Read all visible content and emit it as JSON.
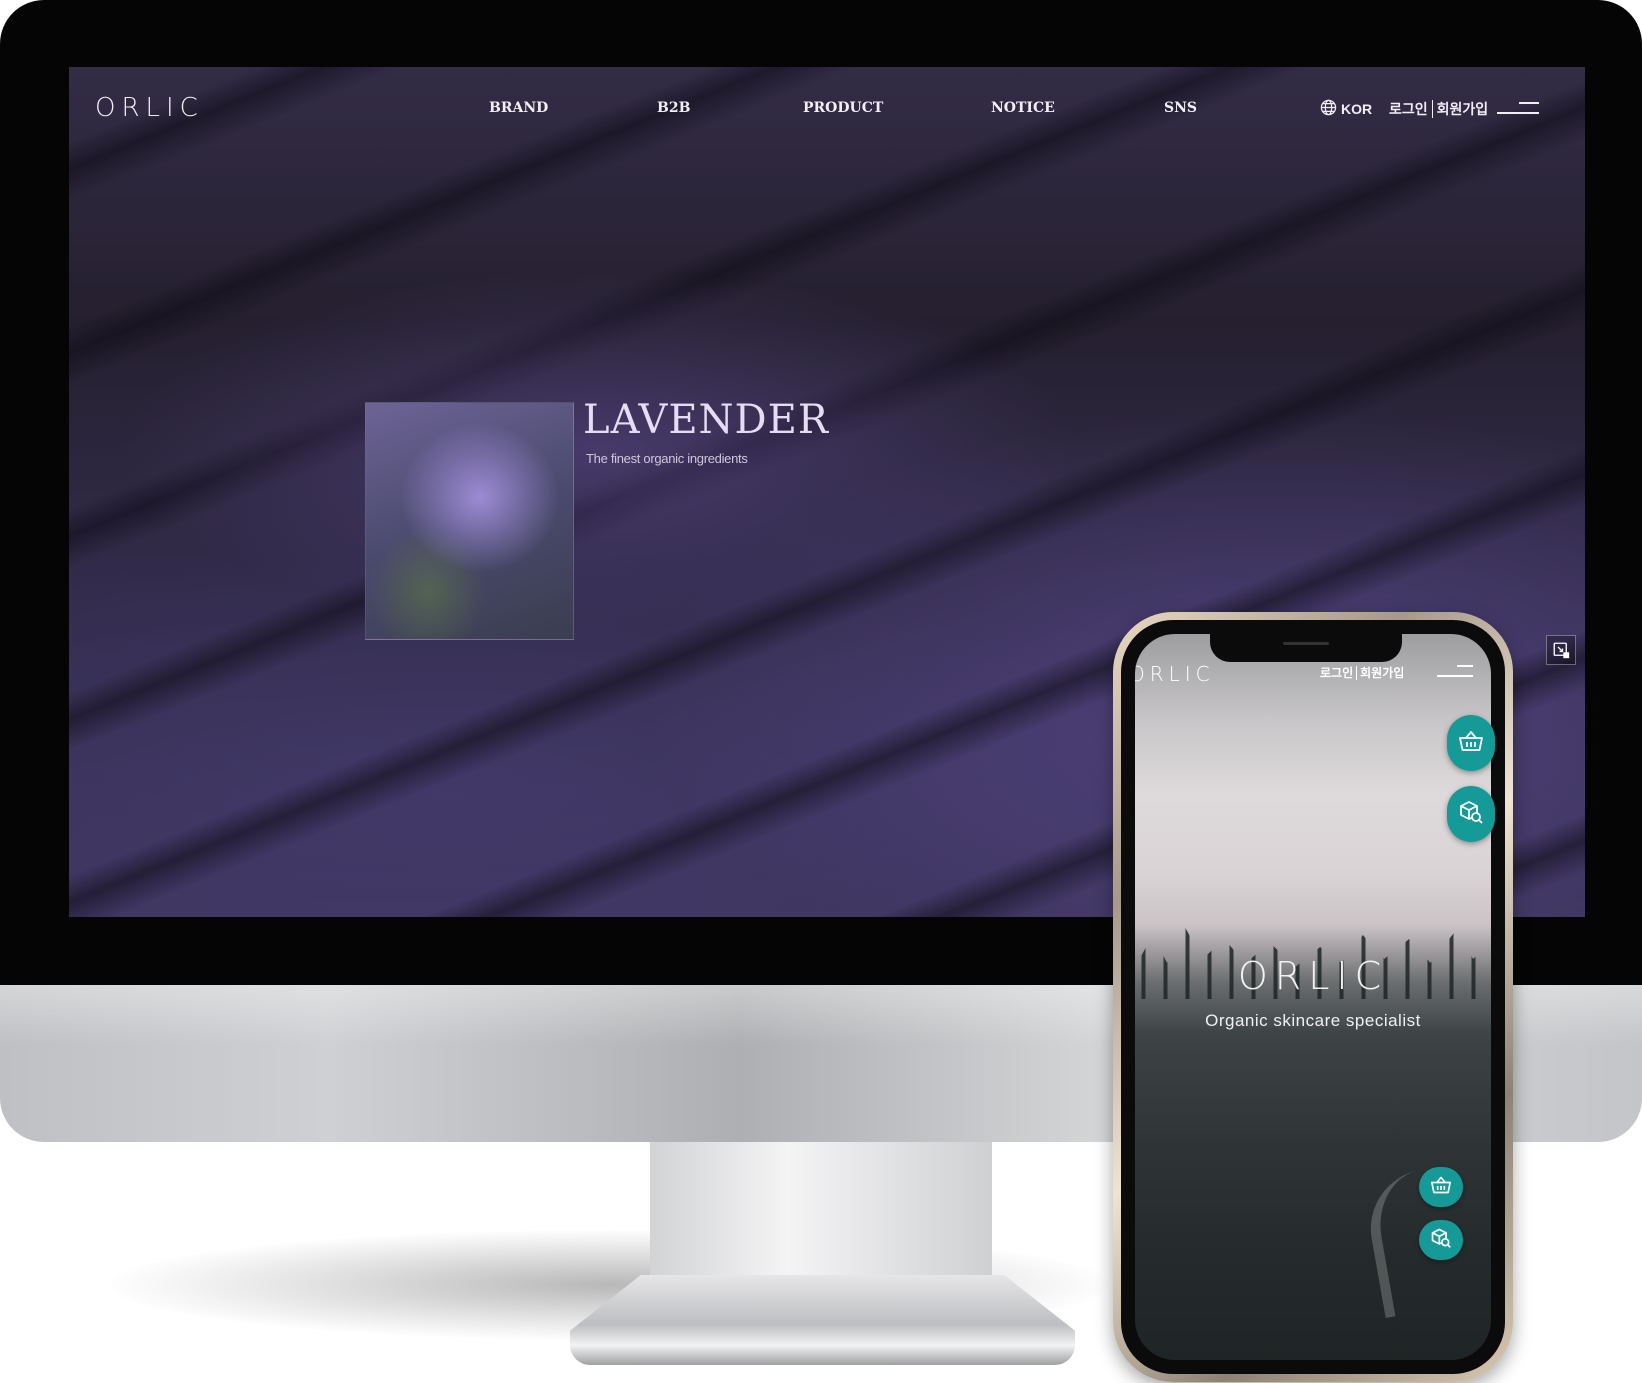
{
  "desktop": {
    "logo": "ORLIC",
    "nav": [
      {
        "label": "BRAND"
      },
      {
        "label": "B2B"
      },
      {
        "label": "PRODUCT"
      },
      {
        "label": "NOTICE"
      },
      {
        "label": "SNS"
      }
    ],
    "language": "KOR",
    "login_label": "로그인",
    "signup_label": "회원가입",
    "hero": {
      "title": "LAVENDER",
      "subtitle": "The finest organic ingredients"
    },
    "floating_buttons": [
      {
        "icon": "basket-icon"
      },
      {
        "icon": "product-search-icon"
      }
    ],
    "expand_icon": "expand-icon"
  },
  "mobile": {
    "logo": "ORLIC",
    "login_label": "로그인",
    "signup_label": "회원가입",
    "hero": {
      "brand": "ORLIC",
      "tagline": "Organic skincare specialist"
    },
    "floating_buttons": [
      {
        "icon": "basket-icon"
      },
      {
        "icon": "product-search-icon"
      }
    ]
  },
  "colors": {
    "accent": "#169a98",
    "header_text": "#f1eef6",
    "hero_title": "#e6dcf5"
  }
}
